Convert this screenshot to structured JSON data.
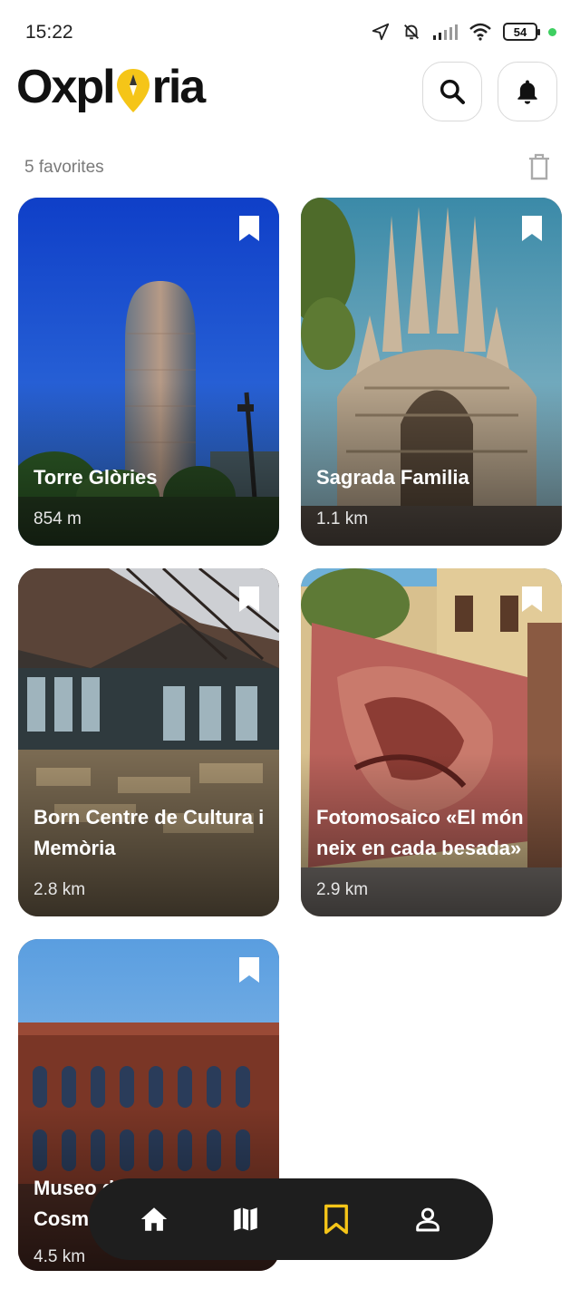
{
  "status": {
    "time": "15:22",
    "battery": "54"
  },
  "app": {
    "logo_left": "Oxpl",
    "logo_right": "ria"
  },
  "favorites": {
    "count_label": "5 favorites"
  },
  "cards": [
    {
      "title": "Torre Glòries",
      "distance": "854 m"
    },
    {
      "title": "Sagrada Familia",
      "distance": "1.1 km"
    },
    {
      "title": "Born Centre de Cultura i Memòria",
      "distance": "2.8 km"
    },
    {
      "title": "Fotomosaico «El món neix en cada besada»",
      "distance": "2.9 km"
    },
    {
      "title": "Museo de la Ciencia CosmoCaixa",
      "distance": "4.5 km"
    }
  ],
  "colors": {
    "accent": "#F5C518",
    "navbar": "#1E1E1E"
  },
  "nav": [
    "home-icon",
    "map-icon",
    "bookmark-icon",
    "profile-icon"
  ]
}
